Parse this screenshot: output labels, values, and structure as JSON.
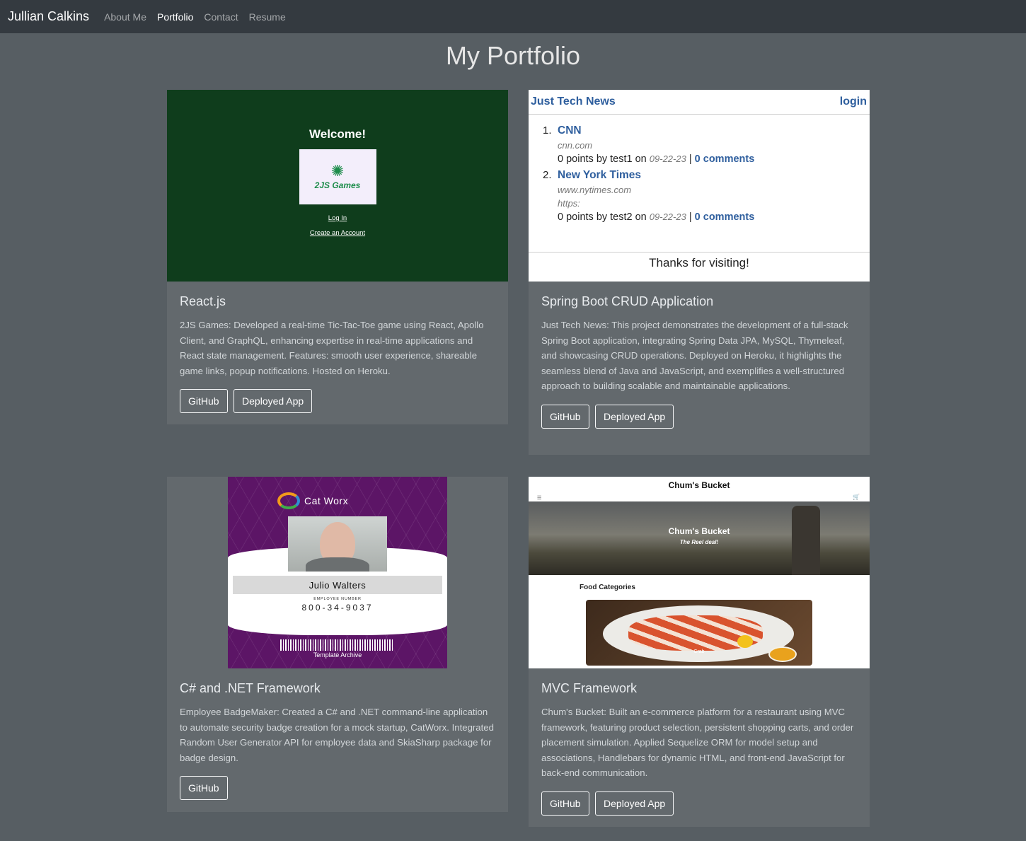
{
  "navbar": {
    "brand": "Jullian Calkins",
    "links": [
      "About Me",
      "Portfolio",
      "Contact",
      "Resume"
    ],
    "active": "Portfolio"
  },
  "page": {
    "title": "My Portfolio"
  },
  "projects": [
    {
      "title": "React.js",
      "description": "2JS Games: Developed a real-time Tic-Tac-Toe game using React, Apollo Client, and GraphQL, enhancing expertise in real-time applications and React state management. Features: smooth user experience, shareable game links, popup notifications. Hosted on Heroku.",
      "buttons": [
        "GitHub",
        "Deployed App"
      ],
      "preview": {
        "welcome": "Welcome!",
        "logo_text": "2JS Games",
        "login": "Log In",
        "create": "Create an Account"
      }
    },
    {
      "title": "Spring Boot CRUD Application",
      "description": "Just Tech News: This project demonstrates the development of a full-stack Spring Boot application, integrating Spring Data JPA, MySQL, Thymeleaf, and showcasing CRUD operations. Deployed on Heroku, it highlights the seamless blend of Java and JavaScript, and exemplifies a well-structured approach to building scalable and maintainable applications.",
      "buttons": [
        "GitHub",
        "Deployed App"
      ],
      "preview": {
        "site": "Just Tech News",
        "login": "login",
        "items": [
          {
            "num": "1.",
            "title": "CNN",
            "source": "cnn.com",
            "extra": "",
            "points": "0 points by test1 on",
            "date": "09-22-23",
            "comments": "0 comments"
          },
          {
            "num": "2.",
            "title": "New York Times",
            "source": "www.nytimes.com",
            "extra": "https:",
            "points": "0 points by test2 on",
            "date": "09-22-23",
            "comments": "0 comments"
          }
        ],
        "footer": "Thanks for visiting!"
      }
    },
    {
      "title": "C# and .NET Framework",
      "description": "Employee BadgeMaker: Created a C# and .NET command-line application to automate security badge creation for a mock startup, CatWorx. Integrated Random User Generator API for employee data and SkiaSharp package for badge design.",
      "buttons": [
        "GitHub"
      ],
      "preview": {
        "company": "Cat Worx",
        "name": "Julio Walters",
        "employee_label": "EMPLOYEE NUMBER",
        "employee_number": "800-34-9037",
        "footer": "Template Archive"
      }
    },
    {
      "title": "MVC Framework",
      "description": "Chum's Bucket: Built an e-commerce platform for a restaurant using MVC framework, featuring product selection, persistent shopping carts, and order placement simulation. Applied Sequelize ORM for model setup and associations, Handlebars for dynamic HTML, and front-end JavaScript for back-end communication.",
      "buttons": [
        "GitHub",
        "Deployed App"
      ],
      "preview": {
        "site": "Chum's Bucket",
        "hero_title": "Chum's Bucket",
        "hero_sub": "The Reel deal!",
        "section": "Food Categories",
        "category": "Crab"
      }
    }
  ],
  "colors": {
    "page_bg": "#575e63",
    "card_bg": "#63696d",
    "navbar_bg": "#343a40"
  }
}
